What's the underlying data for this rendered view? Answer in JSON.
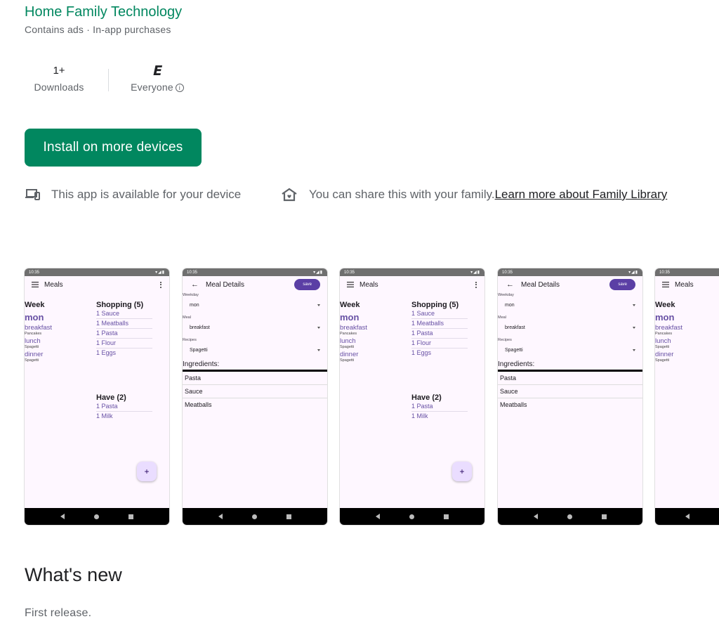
{
  "developer": {
    "name": "Home Family Technology",
    "subtitle": "Contains ads · In-app purchases"
  },
  "stats": {
    "downloads": {
      "value": "1+",
      "label": "Downloads"
    },
    "rating": {
      "badge": "E",
      "label": "Everyone",
      "info_icon": "info-icon"
    }
  },
  "install_button": {
    "label": "Install on more devices",
    "color": "#01875f"
  },
  "availability": {
    "device_text": "This app is available for your device",
    "device_icon": "devices-icon",
    "family_text": "You can share this with your family.",
    "family_link": "Learn more about Family Library",
    "family_icon": "family-home-icon"
  },
  "screenshots": {
    "status_time": "10:35",
    "status_icons": "▾◢▮",
    "meals": {
      "title": "Meals",
      "week_heading": "Week",
      "day": "mon",
      "meals": [
        {
          "label": "breakfast",
          "item": "Pancakes"
        },
        {
          "label": "lunch",
          "item": "Spagetti"
        },
        {
          "label": "dinner",
          "item": "Spagetti"
        }
      ],
      "shopping_heading": "Shopping (5)",
      "shopping": [
        "1 Sauce",
        "1 Meatballs",
        "1 Pasta",
        "1 Flour",
        "1 Eggs"
      ],
      "have_heading": "Have (2)",
      "have": [
        "1 Pasta",
        "1 Milk"
      ],
      "fab": "+"
    },
    "details": {
      "title": "Meal Details",
      "save": "save",
      "weekday_label": "Weekday",
      "weekday_value": "mon",
      "meal_label": "Meal",
      "meal_value": "breakfast",
      "recipes_label": "Recipes",
      "recipes_value": "Spagetti",
      "ingredients_heading": "Ingredients:",
      "ingredients": [
        "Pasta",
        "Sauce",
        "Meatballs"
      ]
    },
    "accent": "#6750a4"
  },
  "whats_new": {
    "heading": "What's new",
    "text": "First release."
  }
}
